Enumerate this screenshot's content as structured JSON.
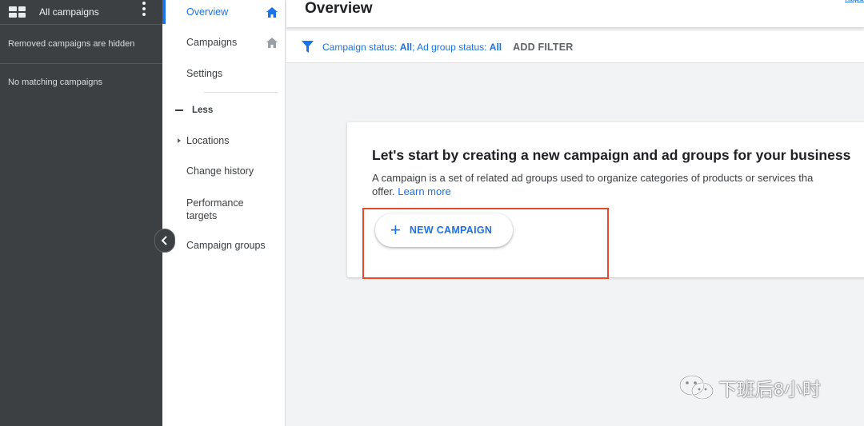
{
  "left_panel": {
    "title": "All campaigns",
    "removed_note": "Removed campaigns are hidden",
    "empty_note": "No matching campaigns"
  },
  "nav": {
    "items": [
      {
        "label": "Overview",
        "active": true
      },
      {
        "label": "Campaigns"
      },
      {
        "label": "Settings"
      },
      {
        "label": "Less"
      },
      {
        "label": "Locations"
      },
      {
        "label": "Change history"
      },
      {
        "label": "Performance targets"
      },
      {
        "label": "Campaign groups"
      }
    ]
  },
  "header": {
    "title": "Overview",
    "link_text": "https"
  },
  "filter": {
    "campaign_status_label": "Campaign status: ",
    "campaign_status_value": "All",
    "ad_group_status_label": "; Ad group status: ",
    "ad_group_status_value": "All",
    "add_filter": "ADD FILTER"
  },
  "card": {
    "title": "Let's start by creating a new campaign and ad groups for your business",
    "description": "A campaign is a set of related ad groups used to organize categories of products or services that you offer.",
    "description_line1": "A campaign is a set of related ad groups used to organize categories of products or services tha",
    "description_line2": "offer. ",
    "learn_more": "Learn more",
    "button_label": "NEW CAMPAIGN"
  },
  "watermark": {
    "text": "下班后8小时"
  },
  "colors": {
    "accent": "#1a73e8",
    "sidebar_bg": "#3c4043",
    "highlight": "#e8492a"
  }
}
